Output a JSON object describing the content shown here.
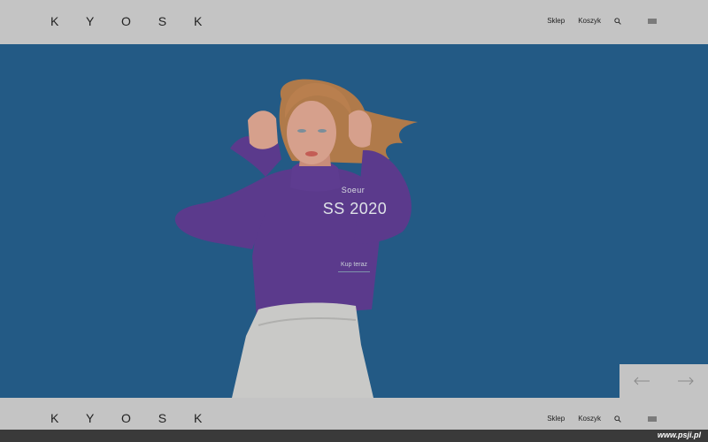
{
  "brand": {
    "logo": "K Y O S K"
  },
  "nav": {
    "shop": "Sklep",
    "cart": "Koszyk"
  },
  "hero": {
    "label": "Soeur",
    "title": "SS 2020",
    "cta": "Kup teraz"
  },
  "slider": {
    "prev_icon": "arrow-left-icon",
    "next_icon": "arrow-right-icon"
  },
  "watermark": "www.psji.pl",
  "colors": {
    "header_bg": "#c4c4c4",
    "hero_bg": "#235a85",
    "sweater": "#5c3a8c",
    "pants": "#c8c8c6"
  }
}
